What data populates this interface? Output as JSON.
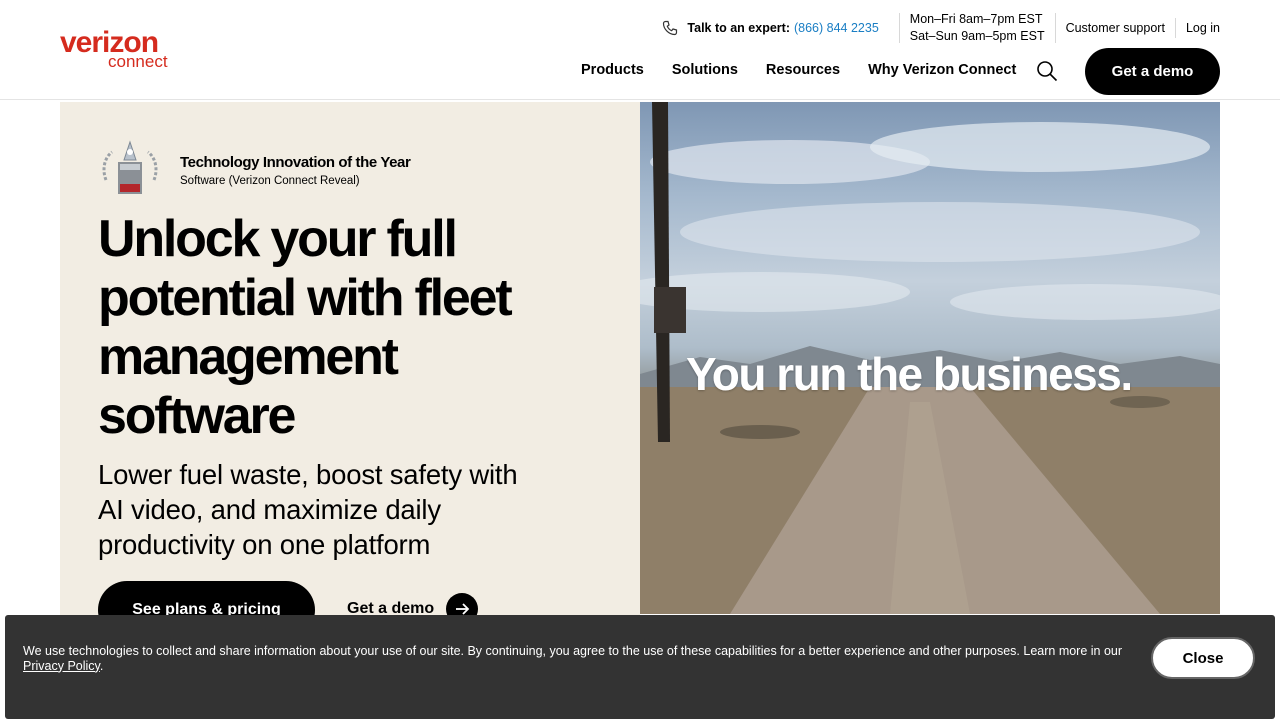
{
  "brand": {
    "logo_word": "verizon",
    "logo_sub": "connect",
    "color": "#d52b1e"
  },
  "utility": {
    "talk_label": "Talk to an expert:",
    "phone": "(866) 844 2235",
    "hours_weekday": "Mon–Fri 8am–7pm EST",
    "hours_weekend": "Sat–Sun 9am–5pm EST",
    "customer_support": "Customer support",
    "login": "Log in"
  },
  "nav": {
    "items": [
      "Products",
      "Solutions",
      "Resources",
      "Why Verizon Connect"
    ],
    "cta": "Get a demo"
  },
  "hero": {
    "award_title": "Technology Innovation of the Year",
    "award_sub": "Software (Verizon Connect Reveal)",
    "headline": "Unlock your full potential with fleet management software",
    "subhead": "Lower fuel waste, boost safety with AI video, and maximize daily productivity on one platform",
    "primary_cta": "See plans & pricing",
    "secondary_cta": "Get a demo",
    "video_caption": "You run the business."
  },
  "cookie": {
    "text": "We use technologies to collect and share information about your use of our site. By continuing, you agree to the use of these capabilities for a better experience and other purposes. Learn more in our ",
    "link": "Privacy Policy",
    "end": ".",
    "close": "Close"
  },
  "icons": {
    "phone": "phone-icon",
    "search": "search-icon",
    "arrow": "arrow-right-icon",
    "award": "award-badge-icon"
  }
}
